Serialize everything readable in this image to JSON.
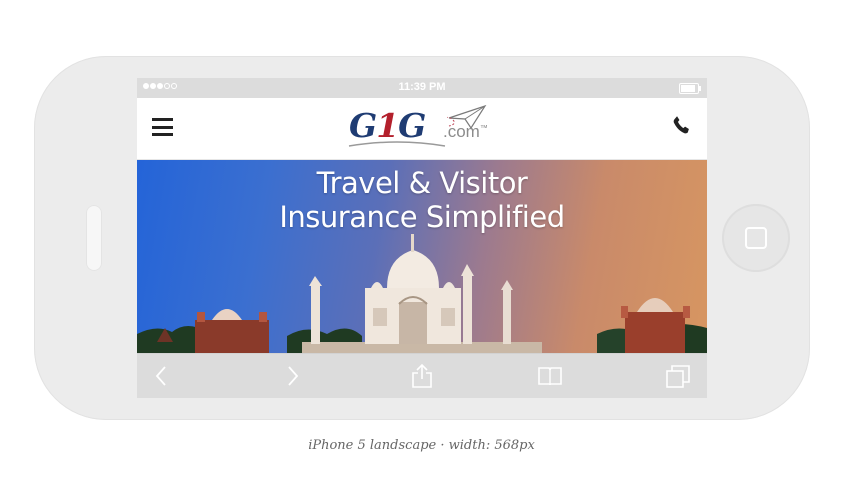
{
  "status_bar": {
    "time": "11:39 PM",
    "signal_icon": "signal-dots-icon",
    "battery_icon": "battery-icon",
    "battery_level": 0.9
  },
  "header": {
    "menu_icon": "hamburger-menu-icon",
    "logo": {
      "part1": "G",
      "part2": "1",
      "part3": "G",
      "suffix": ".com",
      "mark": "™",
      "plane_icon": "paper-plane-icon"
    },
    "phone_icon": "phone-icon"
  },
  "hero": {
    "line1": "Travel & Visitor",
    "line2": "Insurance Simplified"
  },
  "toolbar": {
    "back_icon": "chevron-left-icon",
    "forward_icon": "chevron-right-icon",
    "share_icon": "share-icon",
    "bookmarks_icon": "book-icon",
    "tabs_icon": "tabs-icon"
  },
  "caption": "iPhone 5 landscape · width: 568px",
  "colors": {
    "logo_blue": "#1f3c73",
    "logo_red": "#b3202c",
    "device_body": "#ececec",
    "chrome_gray": "#dcdcdc"
  }
}
